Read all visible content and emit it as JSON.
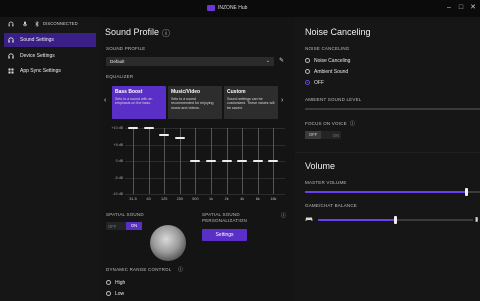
{
  "app": {
    "title": "INZONE Hub"
  },
  "window": {
    "minimize": "–",
    "maximize": "□",
    "close": "✕"
  },
  "status": {
    "connection": "DISCONNECTED",
    "icons": [
      "headset-icon",
      "mic-icon",
      "bluetooth-icon"
    ]
  },
  "sidebar": {
    "items": [
      {
        "label": "Sound Settings",
        "icon": "headphones-icon",
        "active": true
      },
      {
        "label": "Device Settings",
        "icon": "headset-icon",
        "active": false
      },
      {
        "label": "App Sync Settings",
        "icon": "grid-icon",
        "active": false
      }
    ]
  },
  "sound_profile": {
    "title": "Sound Profile",
    "profile_label": "SOUND PROFILE",
    "profile_value": "Default",
    "equalizer_label": "EQUALIZER",
    "presets": [
      {
        "title": "Bass Boost",
        "desc": "Sets to a sound with an emphasis on the bass."
      },
      {
        "title": "Music/Video",
        "desc": "Sets to a sound recommended for enjoying music and videos."
      },
      {
        "title": "Custom",
        "desc": "Sound settings can be customized. These values will be saved."
      }
    ],
    "eq_db_labels": [
      "+10 dB",
      "+5 dB",
      "0 dB",
      "-5 dB",
      "-10 dB"
    ],
    "eq_freqs": [
      "31.5",
      "63",
      "125",
      "250",
      "500",
      "1k",
      "2k",
      "4k",
      "8k",
      "16k"
    ],
    "eq_values": [
      10,
      10,
      8,
      7,
      0,
      0,
      0,
      0,
      0,
      0
    ],
    "spatial_sound_label": "SPATIAL SOUND",
    "spatial_sound": {
      "off": "OFF",
      "on": "ON",
      "state": "on"
    },
    "spatial_personalization_label": "SPATIAL SOUND PERSONALIZATION",
    "settings_button": "Settings",
    "dynamic_range_label": "DYNAMIC RANGE CONTROL",
    "dynamic_range_options": [
      "High",
      "Low"
    ],
    "dynamic_range_selected": "High"
  },
  "noise_canceling": {
    "title": "Noise Canceling",
    "label": "NOISE CANCELING",
    "options": [
      "Noise Canceling",
      "Ambient Sound",
      "OFF"
    ],
    "selected": "OFF",
    "ambient_level_label": "AMBIENT SOUND LEVEL",
    "focus_on_voice_label": "FOCUS ON VOICE",
    "focus_toggle": {
      "off": "OFF",
      "on": "ON",
      "state": "off"
    }
  },
  "volume": {
    "title": "Volume",
    "master_label": "MASTER VOLUME",
    "master_level": 0.92,
    "balance_label": "GAME/CHAT BALANCE",
    "balance_level": 0.5
  },
  "colors": {
    "accent": "#5a2fc7",
    "accent_bright": "#6b3ff0"
  }
}
